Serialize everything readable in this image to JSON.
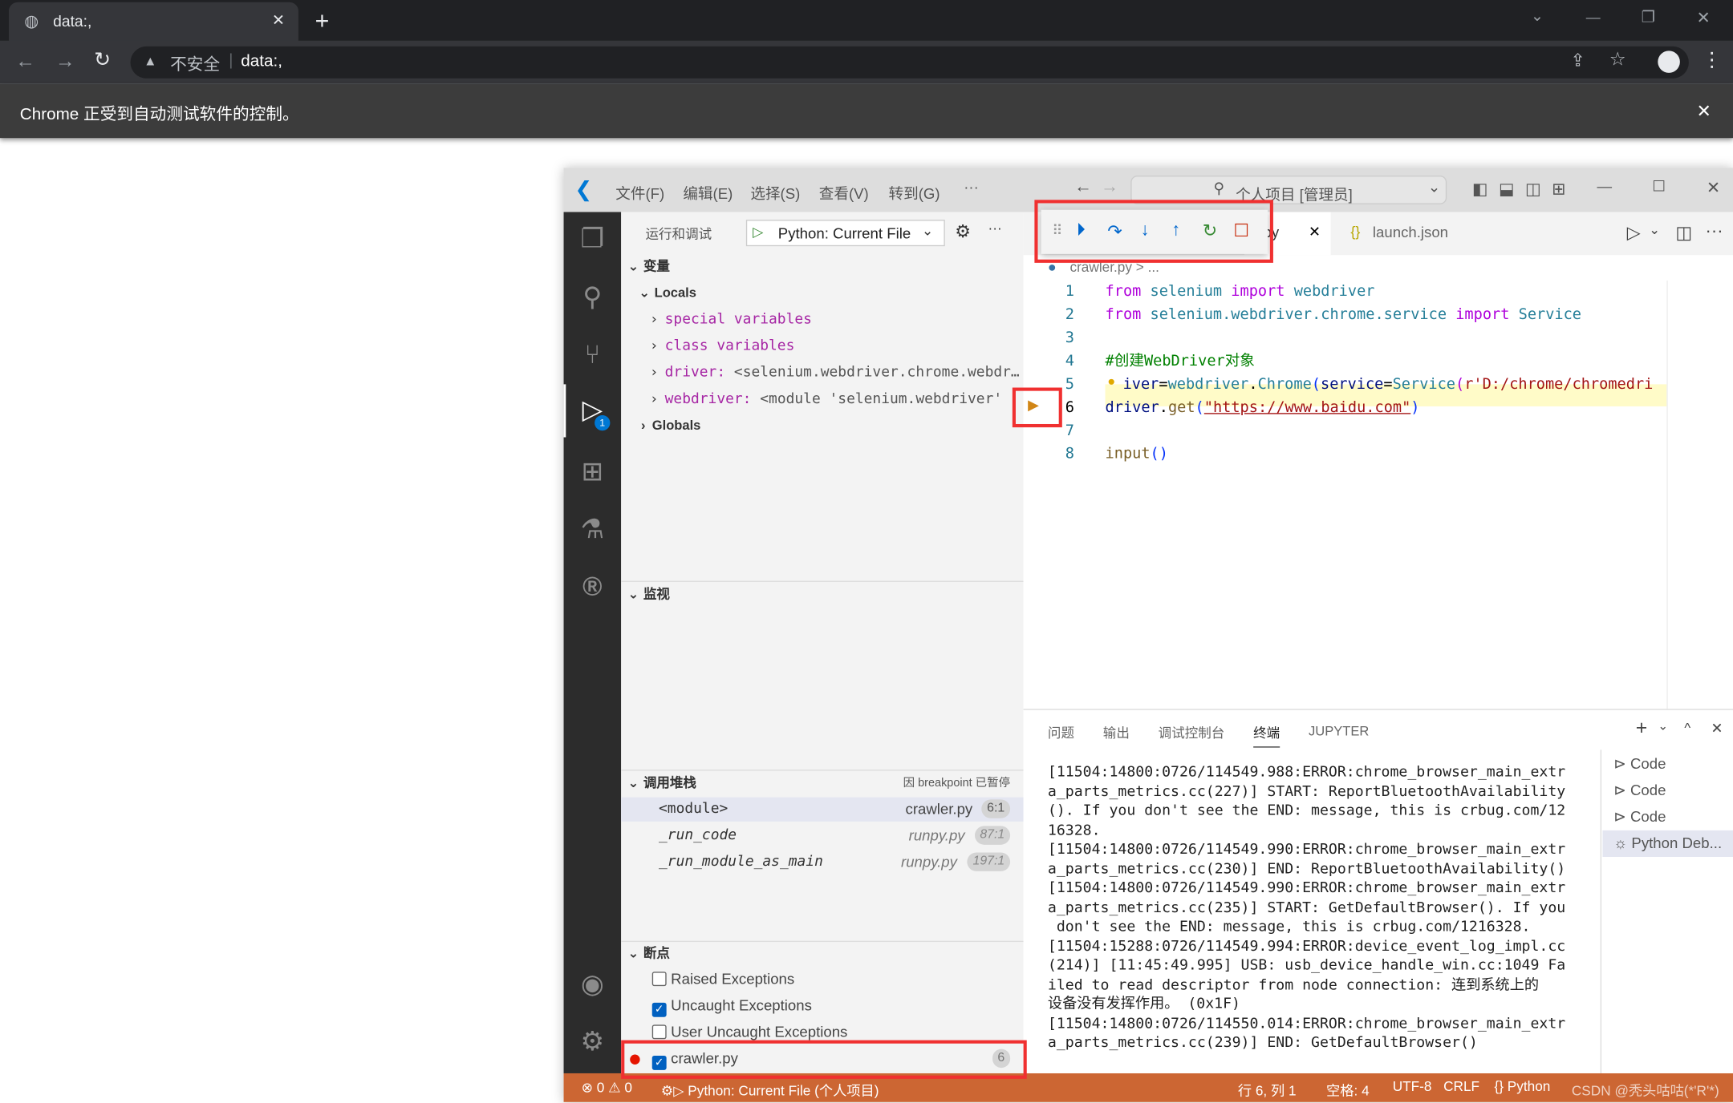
{
  "browser": {
    "tab_title": "data:,",
    "url_warning": "不安全",
    "url": "data:,",
    "infobar": "Chrome 正受到自动测试软件的控制。"
  },
  "vscode": {
    "menu": [
      "文件(F)",
      "编辑(E)",
      "选择(S)",
      "查看(V)",
      "转到(G)",
      "···"
    ],
    "search": "个人项目 [管理员]",
    "sidebar": {
      "title": "运行和调试",
      "config": "Python: Current File",
      "variables": {
        "label": "变量",
        "locals": "Locals",
        "items": [
          {
            "name": "special variables",
            "value": ""
          },
          {
            "name": "class variables",
            "value": ""
          },
          {
            "name": "driver:",
            "value": " <selenium.webdriver.chrome.webdr…"
          },
          {
            "name": "webdriver:",
            "value": " <module 'selenium.webdriver'"
          }
        ],
        "globals": "Globals"
      },
      "watch": "监视",
      "callstack": {
        "label": "调用堆栈",
        "status": "因 breakpoint 已暂停",
        "frames": [
          {
            "name": "<module>",
            "file": "crawler.py",
            "pos": "6:1"
          },
          {
            "name": "_run_code",
            "file": "runpy.py",
            "pos": "87:1"
          },
          {
            "name": "_run_module_as_main",
            "file": "runpy.py",
            "pos": "197:1"
          }
        ]
      },
      "breakpoints": {
        "label": "断点",
        "items": [
          {
            "label": "Raised Exceptions",
            "checked": false
          },
          {
            "label": "Uncaught Exceptions",
            "checked": true
          },
          {
            "label": "User Uncaught Exceptions",
            "checked": false
          },
          {
            "label": "crawler.py",
            "checked": true,
            "line": "6"
          }
        ]
      }
    },
    "tabs": [
      "er.py",
      "launch.json"
    ],
    "breadcrumb": "crawler.py > ...",
    "code_line_numbers": [
      "1",
      "2",
      "3",
      "4",
      "5",
      "6",
      "7",
      "8"
    ],
    "code": {
      "l1": [
        "from",
        " selenium ",
        "import",
        " webdriver"
      ],
      "l2": [
        "from",
        " selenium.webdriver.chrome.service ",
        "import",
        " Service"
      ],
      "l4": "#创建WebDriver对象",
      "l5": [
        "iver",
        "=",
        "webdriver",
        ".",
        "Chrome",
        "(",
        "service",
        "=",
        "Service",
        "(",
        "r'D:/chrome/chromedri"
      ],
      "l6": [
        "driver",
        ".",
        "get",
        "(",
        "\"https://www.baidu.com\"",
        ")"
      ],
      "l8": [
        "input",
        "()"
      ]
    },
    "panel": {
      "tabs": [
        "问题",
        "输出",
        "调试控制台",
        "终端",
        "JUPYTER"
      ],
      "active_tab": "终端",
      "terminal": [
        "[11504:14800:0726/114549.988:ERROR:chrome_browser_main_extr",
        "a_parts_metrics.cc(227)] START: ReportBluetoothAvailability",
        "(). If you don't see the END: message, this is crbug.com/12",
        "16328.",
        "[11504:14800:0726/114549.990:ERROR:chrome_browser_main_extr",
        "a_parts_metrics.cc(230)] END: ReportBluetoothAvailability()",
        "[11504:14800:0726/114549.990:ERROR:chrome_browser_main_extr",
        "a_parts_metrics.cc(235)] START: GetDefaultBrowser(). If you",
        " don't see the END: message, this is crbug.com/1216328.",
        "[11504:15288:0726/114549.994:ERROR:device_event_log_impl.cc",
        "(214)] [11:45:49.995] USB: usb_device_handle_win.cc:1049 Fa",
        "iled to read descriptor from node connection: 连到系统上的",
        "设备没有发挥作用。 (0x1F)",
        "[11504:14800:0726/114550.014:ERROR:chrome_browser_main_extr",
        "a_parts_metrics.cc(239)] END: GetDefaultBrowser()"
      ],
      "terminals": [
        "Code",
        "Code",
        "Code",
        "Python Deb..."
      ]
    },
    "status": {
      "errors": "0",
      "warnings": "0",
      "debug": "Python: Current File (个人项目)",
      "position": "行 6, 列 1",
      "spaces": "空格: 4",
      "encoding": "UTF-8",
      "eol": "CRLF",
      "language": "Python",
      "watermark": "CSDN @秃头咕咕(*'R'*)"
    },
    "debug_badge": "1",
    "colors": {
      "statusbar": "#cc6633",
      "highlight_box": "#f03030",
      "debug_accent": "#0066cc"
    }
  }
}
